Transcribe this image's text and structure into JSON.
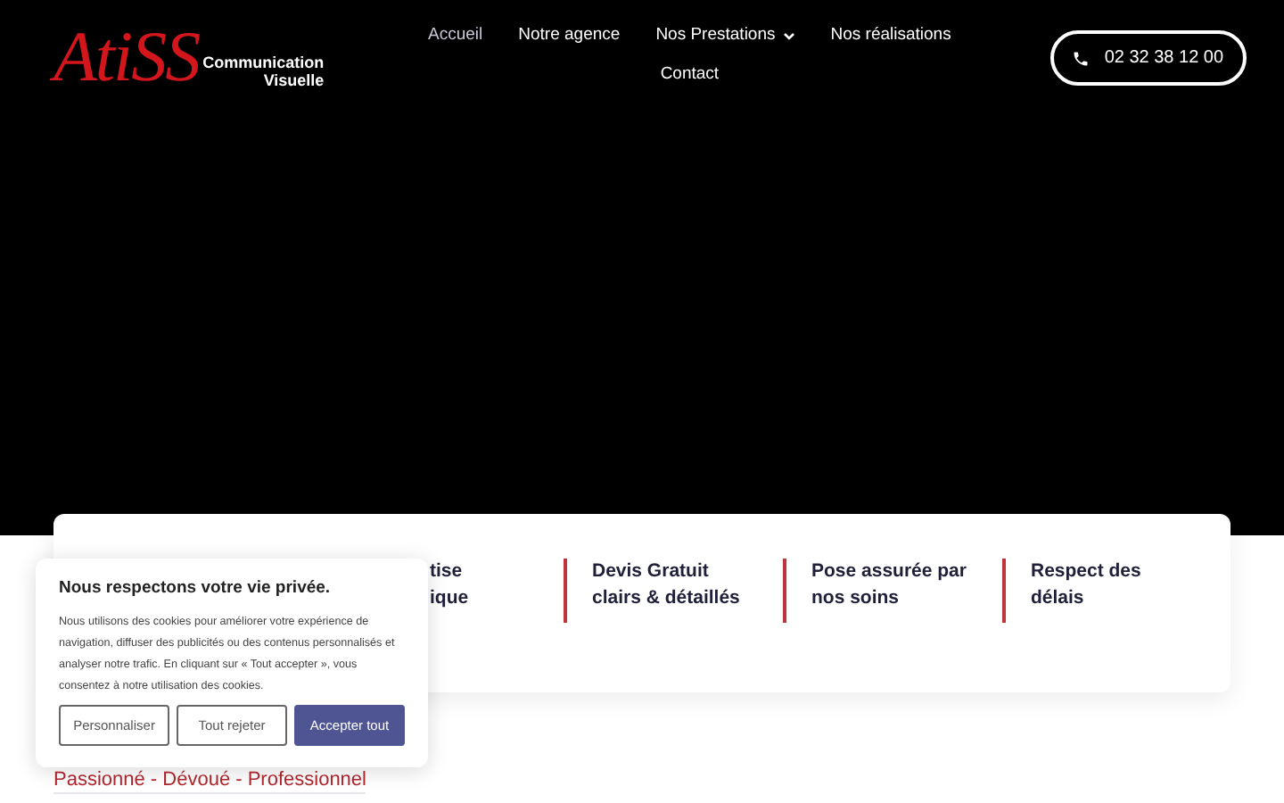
{
  "logo": {
    "mark": "AtiSS",
    "line_1": "Communication",
    "line_2": "Visuelle"
  },
  "nav": [
    {
      "label": "Accueil",
      "selected": true,
      "dropdown": false
    },
    {
      "label": "Notre agence",
      "selected": false,
      "dropdown": false
    },
    {
      "label": "Nos Prestations",
      "selected": false,
      "dropdown": true
    },
    {
      "label": "Nos réalisations",
      "selected": false,
      "dropdown": false
    },
    {
      "label": "Contact",
      "selected": false,
      "dropdown": false
    }
  ],
  "phone": "02 32 38 12 00",
  "features": [
    {
      "lines": [
        "tise",
        "ique"
      ],
      "divider": false
    },
    {
      "lines": [
        "Devis Gratuit",
        "clairs & détaillés"
      ],
      "divider": true
    },
    {
      "lines": [
        "Pose assurée par",
        "nos soins"
      ],
      "divider": true
    },
    {
      "lines": [
        "Respect des",
        "délais"
      ],
      "divider": true
    }
  ],
  "tagline": "Passionné - Dévoué - Professionnel",
  "cookie": {
    "title": "Nous respectons votre vie privée.",
    "text": "Nous utilisons des cookies pour améliorer votre expérience de navigation, diffuser des publicités ou des contenus personnalisés et analyser notre trafic. En cliquant sur « Tout accepter », vous consentez à notre utilisation des cookies.",
    "buttons": [
      {
        "label": "Personnaliser",
        "kind": "outline"
      },
      {
        "label": "Tout rejeter",
        "kind": "outline"
      },
      {
        "label": "Accepter tout",
        "kind": "primary"
      }
    ]
  }
}
